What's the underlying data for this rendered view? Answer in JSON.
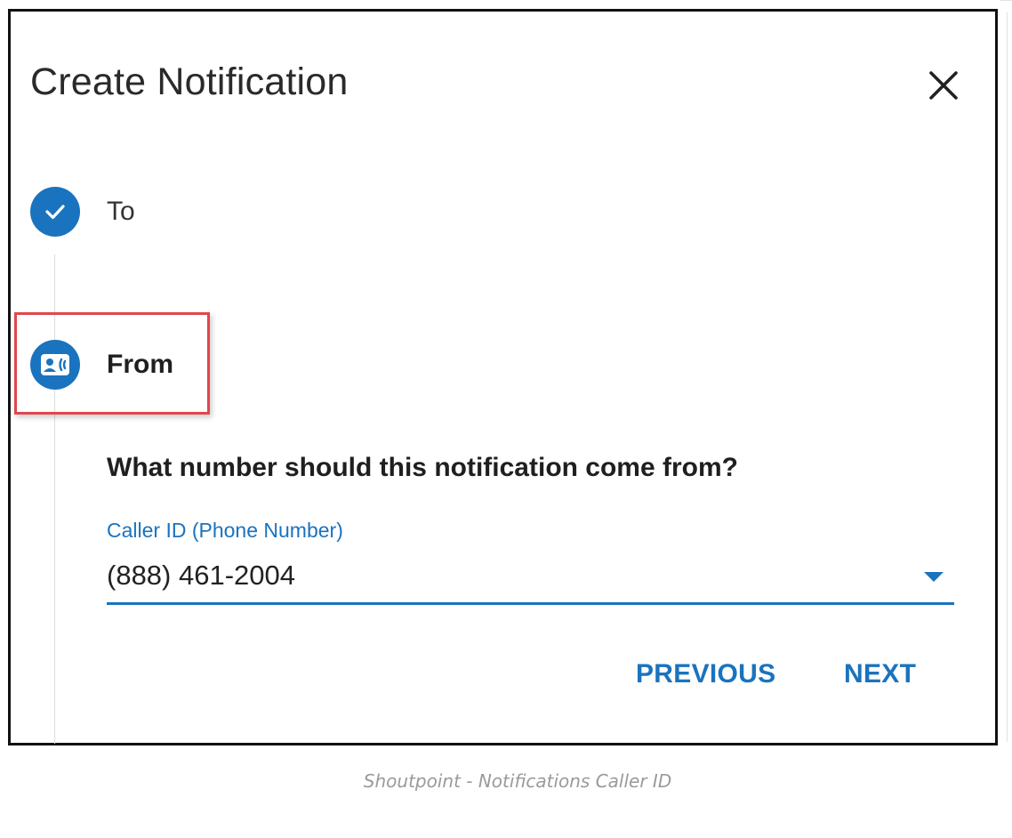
{
  "dialog": {
    "title": "Create Notification",
    "close_icon": "close-icon"
  },
  "steps": [
    {
      "label": "To",
      "state": "completed",
      "icon": "check-icon"
    },
    {
      "label": "From",
      "state": "active",
      "icon": "contact-card-icon"
    }
  ],
  "from_step": {
    "question": "What number should this notification come from?",
    "caller_id": {
      "label": "Caller ID (Phone Number)",
      "value": "(888) 461-2004",
      "icon": "dropdown-arrow-icon"
    }
  },
  "actions": {
    "previous_label": "PREVIOUS",
    "next_label": "NEXT"
  },
  "caption": "Shoutpoint - Notifications Caller ID",
  "colors": {
    "accent": "#1a73be",
    "highlight": "#e0474c",
    "frame": "#111111"
  }
}
